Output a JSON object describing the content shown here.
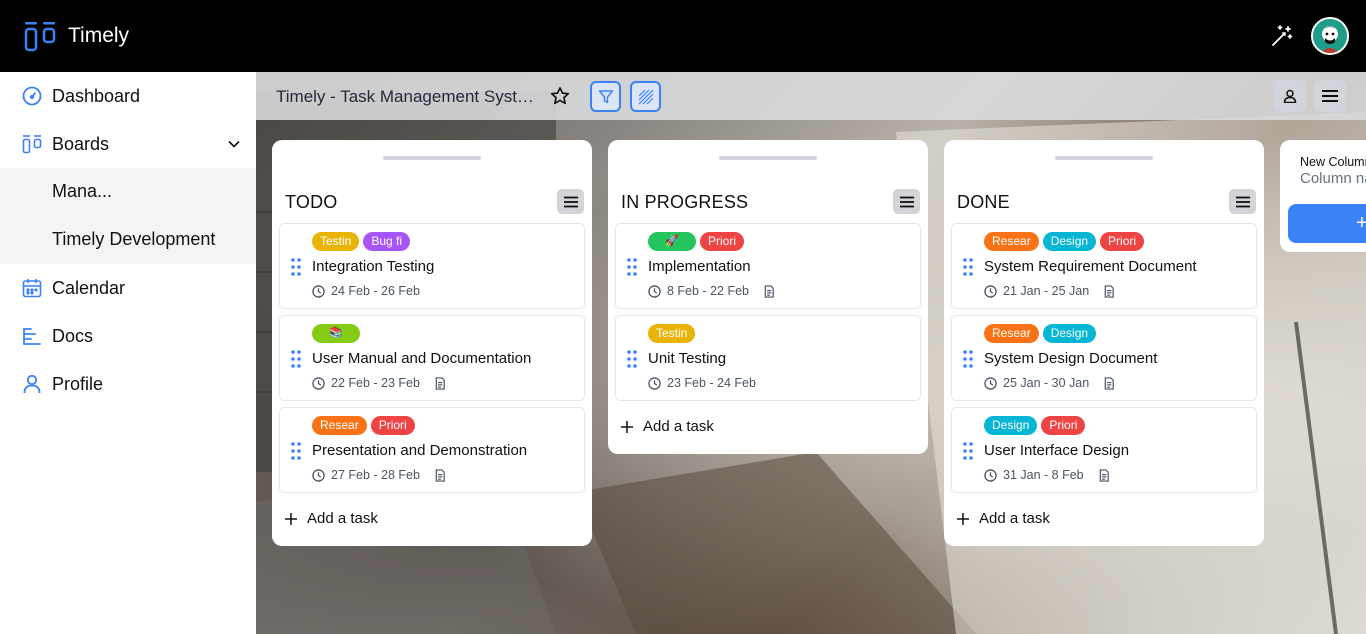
{
  "app": {
    "name": "Timely"
  },
  "sidebar": {
    "items": [
      {
        "label": "Dashboard"
      },
      {
        "label": "Boards"
      },
      {
        "label": "Calendar"
      },
      {
        "label": "Docs"
      },
      {
        "label": "Profile"
      }
    ],
    "boards": [
      "Mana...",
      "Timely Development"
    ]
  },
  "board": {
    "title": "Timely - Task Management System"
  },
  "columns": [
    {
      "title": "TODO",
      "add_task": "Add a task",
      "cards": [
        {
          "tags": [
            "Testin",
            "Bug fi"
          ],
          "title": "Integration Testing",
          "dates": "24 Feb - 26 Feb",
          "has_doc": false
        },
        {
          "tags": [
            "📚"
          ],
          "title": "User Manual and Documentation",
          "dates": "22 Feb - 23 Feb",
          "has_doc": true
        },
        {
          "tags": [
            "Resear",
            "Priori"
          ],
          "title": "Presentation and Demonstration",
          "dates": "27 Feb - 28 Feb",
          "has_doc": true
        }
      ]
    },
    {
      "title": "IN PROGRESS",
      "add_task": "Add a task",
      "cards": [
        {
          "tags": [
            "🚀",
            "Priori"
          ],
          "title": "Implementation",
          "dates": "8 Feb - 22 Feb",
          "has_doc": true
        },
        {
          "tags": [
            "Testin"
          ],
          "title": "Unit Testing",
          "dates": "23 Feb - 24 Feb",
          "has_doc": false
        }
      ]
    },
    {
      "title": "DONE",
      "add_task": "Add a task",
      "cards": [
        {
          "tags": [
            "Resear",
            "Design",
            "Priori"
          ],
          "title": "System Requirement Document",
          "dates": "21 Jan - 25 Jan",
          "has_doc": true
        },
        {
          "tags": [
            "Resear",
            "Design"
          ],
          "title": "System Design Document",
          "dates": "25 Jan - 30 Jan",
          "has_doc": true
        },
        {
          "tags": [
            "Design",
            "Priori"
          ],
          "title": "User Interface Design",
          "dates": "31 Jan - 8 Feb",
          "has_doc": true
        }
      ]
    }
  ],
  "new_column": {
    "label": "New Column",
    "placeholder": "Column name",
    "button": "+"
  },
  "tag_colors": {
    "Testin": "#eab308",
    "Bug fi": "#a855f7",
    "📚": "#84cc16",
    "Resear": "#f97316",
    "Priori": "#ef4444",
    "🚀": "#22c55e",
    "Design": "#06b6d4"
  },
  "accent": "#3b82f6"
}
